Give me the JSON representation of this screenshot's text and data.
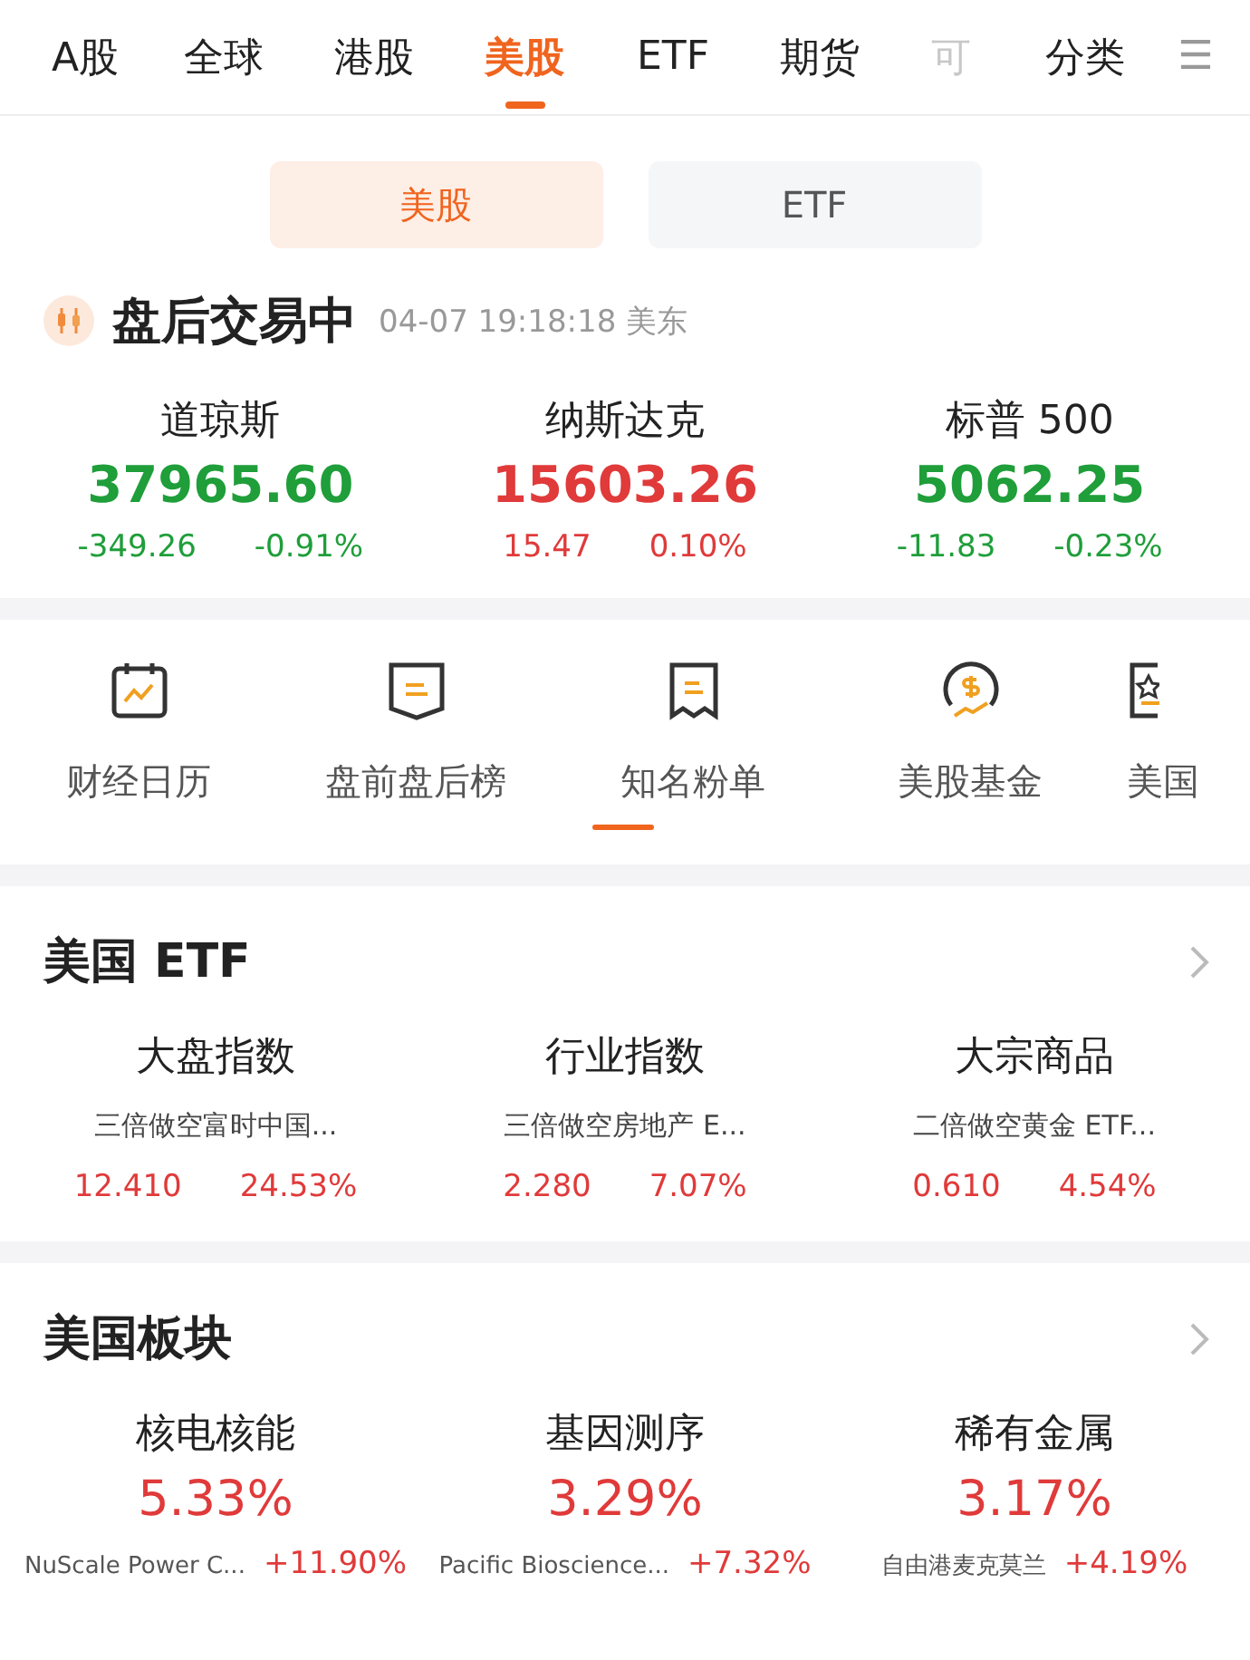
{
  "tabs": [
    {
      "label": "A股",
      "selected": false,
      "faded": false
    },
    {
      "label": "全球",
      "selected": false,
      "faded": false
    },
    {
      "label": "港股",
      "selected": false,
      "faded": false
    },
    {
      "label": "美股",
      "selected": true,
      "faded": false
    },
    {
      "label": "ETF",
      "selected": false,
      "faded": false
    },
    {
      "label": "期货",
      "selected": false,
      "faded": false
    },
    {
      "label": "可",
      "selected": false,
      "faded": true
    }
  ],
  "category_tab": {
    "label": "分类"
  },
  "menu_glyph": "☰",
  "segments": [
    {
      "label": "美股",
      "selected": true
    },
    {
      "label": "ETF",
      "selected": false
    }
  ],
  "market_status": {
    "label": "盘后交易中",
    "time": "04-07 19:18:18 美东"
  },
  "indices": [
    {
      "name": "道琼斯",
      "value": "37965.60",
      "change": "-349.26",
      "percent": "-0.91%",
      "color": "#1f9e3a"
    },
    {
      "name": "纳斯达克",
      "value": "15603.26",
      "change": "15.47",
      "percent": "0.10%",
      "color": "#e03a3a"
    },
    {
      "name": "标普 500",
      "value": "5062.25",
      "change": "-11.83",
      "percent": "-0.23%",
      "color": "#1f9e3a"
    }
  ],
  "shortcuts": [
    {
      "label": "财经日历",
      "kind": "calendar"
    },
    {
      "label": "盘前盘后榜",
      "kind": "banner"
    },
    {
      "label": "知名粉单",
      "kind": "receipt"
    },
    {
      "label": "美股基金",
      "kind": "coin"
    },
    {
      "label": "美国",
      "kind": "star"
    }
  ],
  "etf_section": {
    "title": "美国 ETF",
    "items": [
      {
        "name": "大盘指数",
        "fund": "三倍做空富时中国...",
        "price": "12.410",
        "percent": "24.53%",
        "color": "#e03a3a"
      },
      {
        "name": "行业指数",
        "fund": "三倍做空房地产 E...",
        "price": "2.280",
        "percent": "7.07%",
        "color": "#e03a3a"
      },
      {
        "name": "大宗商品",
        "fund": "二倍做空黄金 ETF...",
        "price": "0.610",
        "percent": "4.54%",
        "color": "#e03a3a"
      }
    ]
  },
  "sector_section": {
    "title": "美国板块",
    "items": [
      {
        "name": "核电核能",
        "percent": "5.33%",
        "leader": "NuScale Power C...",
        "leader_percent": "+11.90%",
        "color": "#e03a3a"
      },
      {
        "name": "基因测序",
        "percent": "3.29%",
        "leader": "Pacific Bioscience...",
        "leader_percent": "+7.32%",
        "color": "#e03a3a"
      },
      {
        "name": "稀有金属",
        "percent": "3.17%",
        "leader": "自由港麦克莫兰",
        "leader_percent": "+4.19%",
        "color": "#e03a3a"
      }
    ]
  }
}
